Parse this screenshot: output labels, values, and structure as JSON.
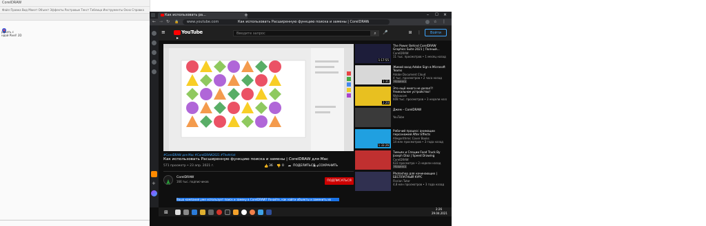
{
  "left_app": {
    "title": "CorelDRAW",
    "menu": "Файл  Правка  Вид  Макет  Объект  Эффекты  Растровые  Текст  Таблица  Инструменты  Окно  Справка",
    "sidebar_lines": [
      "ровать с",
      "ндой Pixel! 2D"
    ]
  },
  "browser": {
    "tab_title": "Как использовать ра...",
    "url": "www.youtube.com",
    "page_title": "Как использовать Расширенную функцию поиска и замены | CorelDRAW для Mac – YouTube"
  },
  "youtube": {
    "logo": "YouTube",
    "search_placeholder": "Введите запрос",
    "signin_label": "Войти",
    "hashtags": "#CorelDRAW для Mac #CorelDRAW2021 #TheArtist",
    "video_title": "Как использовать Расширенную функцию поиска и замены | CorelDRAW для Mac",
    "views_date": "571 просмотр • 23 апр. 2021 г.",
    "likes": "36",
    "dislikes": "0",
    "share_label": "ПОДЕЛИТЬСЯ",
    "save_label": "СОХРАНИТЬ",
    "channel_name": "CorelDRAW",
    "subscribers": "166 тыс. подписчиков",
    "subscribe_label": "ПОДПИСАТЬСЯ",
    "description_snippet": "Ваша компания уже использует поиск и замену в CorelDRAW? Узнайте, как найти объекты и заменить их",
    "recommendations": [
      {
        "title": "The Power Behind CorelDRAW Graphics Suite 2021 | Полный...",
        "channel": "CorelDRAW",
        "meta": "11 тыс. просмотров • 1 месяц назад",
        "duration": "1:17:55",
        "color": "#1d1d3a"
      },
      {
        "title": "Живой вход Adobe Sign в Microsoft Teams",
        "channel": "Adobe Document Cloud",
        "meta": "4 тыс. просмотров • 2 часа назад",
        "duration": "1:31",
        "badge": "Новинка",
        "color": "#d8d8d8"
      },
      {
        "title": "Это ещё много не делал?! Уникальное устройство!",
        "channel": "Wylsacom",
        "meta": "608 тыс. просмотров • 3 недели назад",
        "duration": "2:20",
        "color": "#e8c020"
      },
      {
        "title": "Джем – CorelDRAW",
        "channel": "YouTube",
        "meta": "",
        "duration": "",
        "color": "#3a3a3a"
      },
      {
        "title": "Рабочий процесс анимации персонажей After Effects",
        "channel": "Allegorithmic Cover Books",
        "meta": "14 млн просмотров • 3 года назад",
        "duration": "1:33:26",
        "color": "#20a0e0"
      },
      {
        "title": "Тимьян и Специи Food Truck By Joseph Diaz | Speed Drawing",
        "channel": "CorelDRAW",
        "meta": "633 просмотра • 2 недели назад",
        "duration": "",
        "badge": "Новинка",
        "color": "#c03030"
      },
      {
        "title": "Photoshop для начинающих | БЕСПЛАТНЫЙ КУРС",
        "channel": "Florian Tutor",
        "meta": "4,8 млн просмотров • 3 года назад",
        "duration": "",
        "color": "#303050"
      }
    ]
  },
  "taskbar": {
    "time": "2:26",
    "date": "29.04.2021"
  },
  "colors": {
    "yt_red": "#ff0000",
    "subscribe_red": "#cc0000",
    "link_blue": "#3ea6ff",
    "selection_blue": "#1a73e8"
  }
}
